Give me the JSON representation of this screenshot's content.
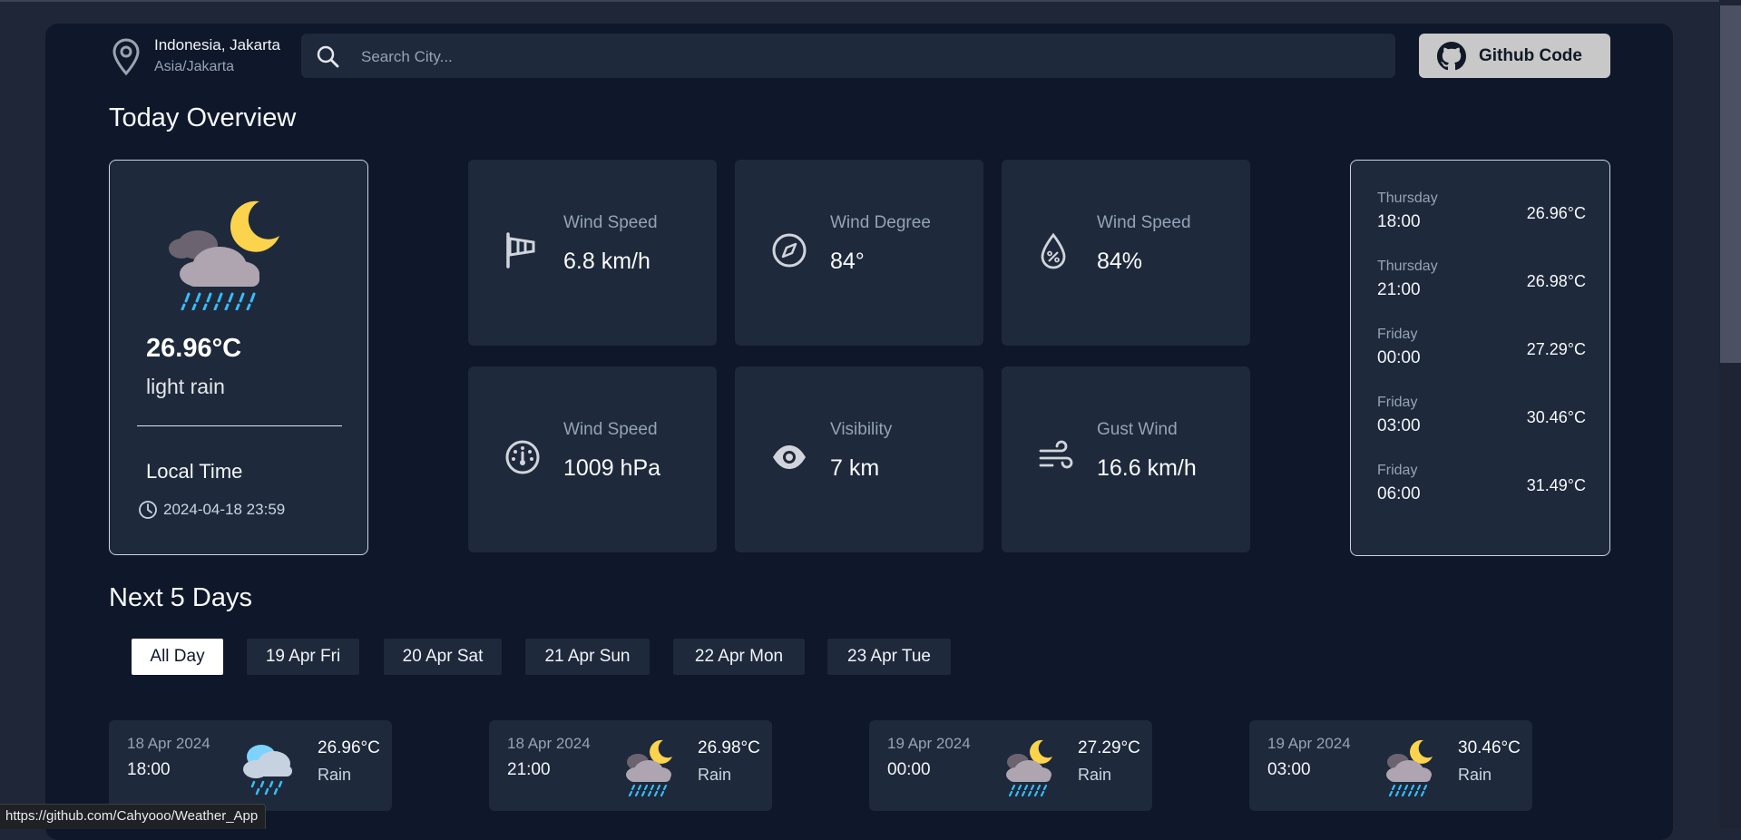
{
  "header": {
    "location_city": "Indonesia, Jakarta",
    "location_timezone": "Asia/Jakarta",
    "search_placeholder": "Search City...",
    "github_label": "Github Code"
  },
  "today": {
    "heading": "Today Overview",
    "temperature": "26.96°C",
    "description": "light rain",
    "local_time_label": "Local Time",
    "local_time_value": "2024-04-18 23:59",
    "icon": "night-cloud-rain-icon"
  },
  "stats": [
    {
      "label": "Wind Speed",
      "value": "6.8 km/h",
      "icon": "windsock-icon"
    },
    {
      "label": "Wind Degree",
      "value": "84°",
      "icon": "compass-icon"
    },
    {
      "label": "Wind Speed",
      "value": "84%",
      "icon": "humidity-drop-icon"
    },
    {
      "label": "Wind Speed",
      "value": "1009 hPa",
      "icon": "pressure-gauge-icon"
    },
    {
      "label": "Visibility",
      "value": "7 km",
      "icon": "eye-icon"
    },
    {
      "label": "Gust Wind",
      "value": "16.6 km/h",
      "icon": "wind-icon"
    }
  ],
  "hourly": [
    {
      "day": "Thursday",
      "time": "18:00",
      "temp": "26.96°C"
    },
    {
      "day": "Thursday",
      "time": "21:00",
      "temp": "26.98°C"
    },
    {
      "day": "Friday",
      "time": "00:00",
      "temp": "27.29°C"
    },
    {
      "day": "Friday",
      "time": "03:00",
      "temp": "30.46°C"
    },
    {
      "day": "Friday",
      "time": "06:00",
      "temp": "31.49°C"
    }
  ],
  "next_days": {
    "heading": "Next 5 Days",
    "tabs": [
      "All Day",
      "19 Apr Fri",
      "20 Apr Sat",
      "21 Apr Sun",
      "22 Apr Mon",
      "23 Apr Tue"
    ],
    "active_tab": "All Day",
    "cards": [
      {
        "date": "18 Apr 2024",
        "time": "18:00",
        "temp": "26.96°C",
        "condition": "Rain",
        "icon": "cloud-rain-icon"
      },
      {
        "date": "18 Apr 2024",
        "time": "21:00",
        "temp": "26.98°C",
        "condition": "Rain",
        "icon": "night-cloud-rain-icon"
      },
      {
        "date": "19 Apr 2024",
        "time": "00:00",
        "temp": "27.29°C",
        "condition": "Rain",
        "icon": "night-cloud-rain-icon"
      },
      {
        "date": "19 Apr 2024",
        "time": "03:00",
        "temp": "30.46°C",
        "condition": "Rain",
        "icon": "night-cloud-rain-icon"
      }
    ]
  },
  "status_bar": {
    "url": "https://github.com/Cahyooo/Weather_App"
  },
  "colors": {
    "background": "#0f172a",
    "card": "#1e293b",
    "accent_rain": "#38bdf8",
    "moon": "#fcd34d"
  }
}
